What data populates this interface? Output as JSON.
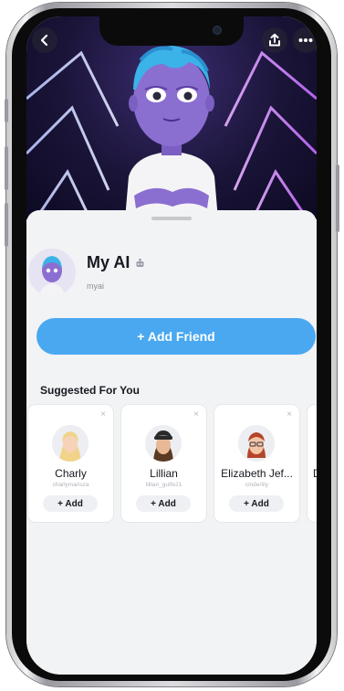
{
  "header": {
    "back_icon": "chevron-left-icon",
    "share_icon": "share-upload-icon",
    "more_icon": "more-dots-icon"
  },
  "profile": {
    "name": "My AI",
    "badge_icon": "bot-badge-icon",
    "username": "myai"
  },
  "actions": {
    "add_friend_label": "+ Add Friend"
  },
  "suggested": {
    "title": "Suggested For You",
    "dismiss_glyph": "×",
    "items": [
      {
        "name": "Charly",
        "username": "charlymarisza",
        "add_label": "+ Add",
        "hair": "#f1d48a",
        "skin": "#f6d2b8"
      },
      {
        "name": "Lillian",
        "username": "lillian_gulfe21",
        "add_label": "+ Add",
        "hair": "#5a3a22",
        "skin": "#e9b894"
      },
      {
        "name": "Elizabeth Jef...",
        "username": "cinderlily",
        "add_label": "+ Add",
        "hair": "#b5452a",
        "skin": "#f3c5a8"
      },
      {
        "name": "Dr",
        "username": "",
        "add_label": "",
        "hair": "#888888",
        "skin": "#eeeeee"
      }
    ]
  },
  "colors": {
    "accent": "#4aa8f0",
    "banner": "#1a1438",
    "ai_skin": "#8b6fd0",
    "ai_hair": "#3bb3e8"
  }
}
